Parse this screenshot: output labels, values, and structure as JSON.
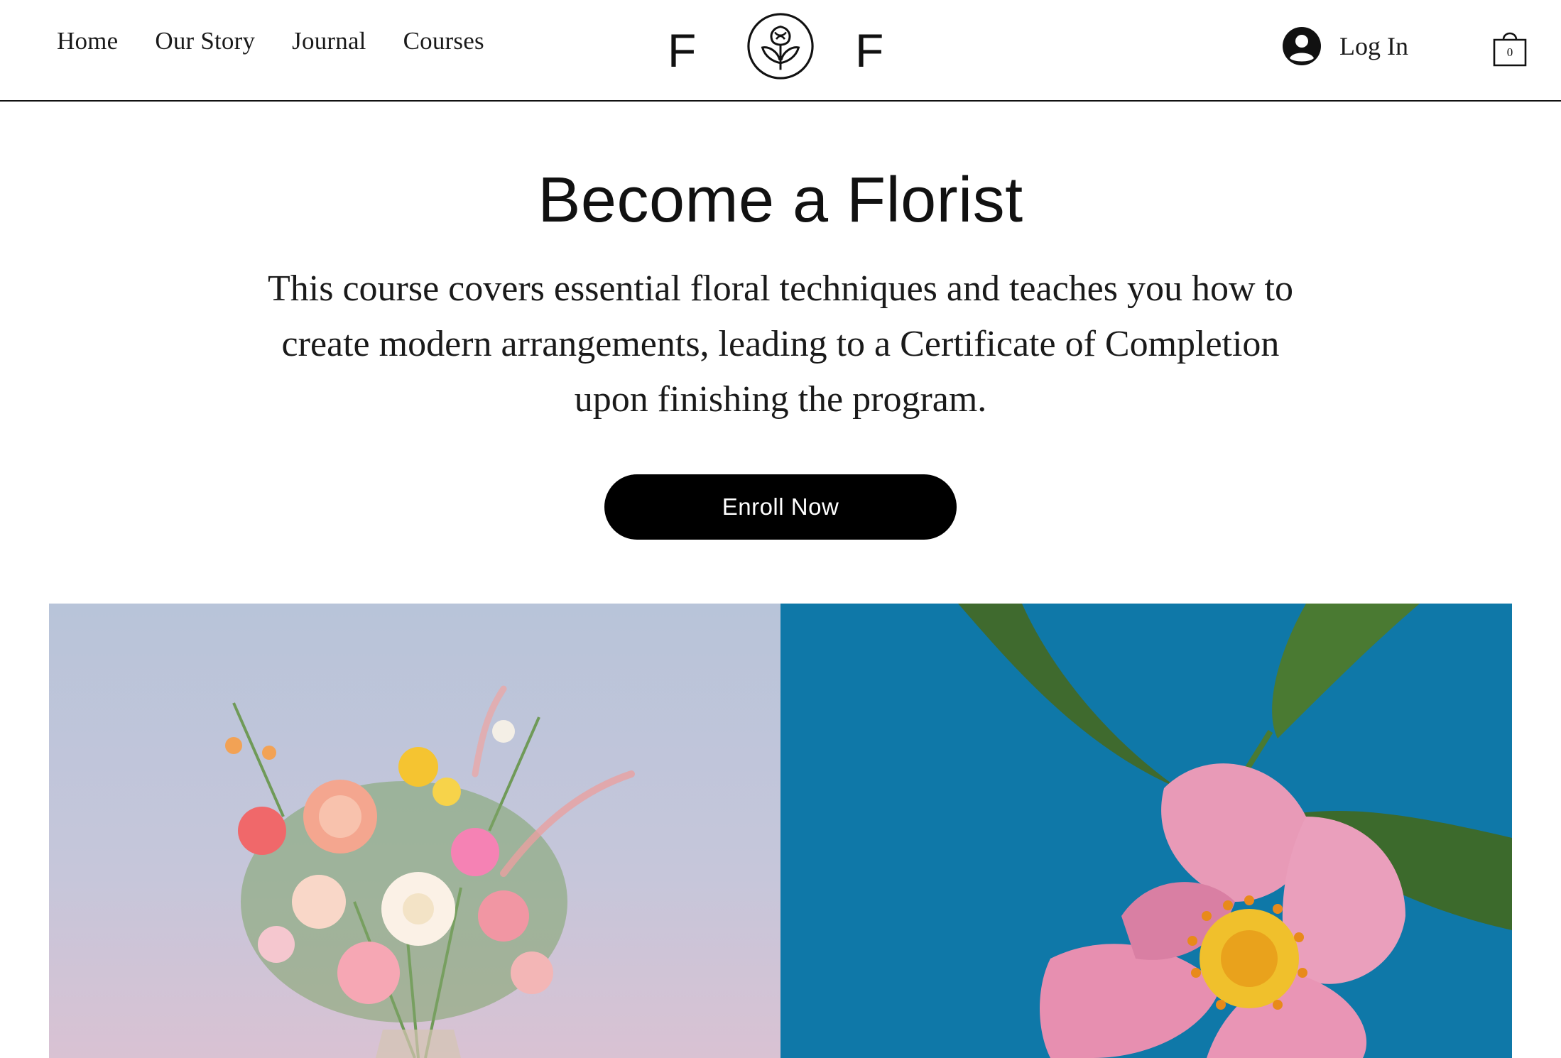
{
  "header": {
    "nav": [
      {
        "label": "Home"
      },
      {
        "label": "Our Story"
      },
      {
        "label": "Journal"
      },
      {
        "label": "Courses"
      }
    ],
    "logo": {
      "left_letter": "F",
      "right_letter": "F",
      "emblem_icon": "rose-in-hands-icon"
    },
    "login": {
      "label": "Log In",
      "icon": "user-avatar-icon"
    },
    "cart": {
      "count": "0",
      "icon": "shopping-bag-icon"
    }
  },
  "hero": {
    "title": "Become a Florist",
    "description": "This course covers essential floral techniques and teaches you how to create modern arrangements, leading to a Certificate of Completion upon finishing the program.",
    "cta_label": "Enroll Now"
  },
  "gallery": {
    "images": [
      {
        "subject": "pastel flower bouquet in vase"
      },
      {
        "subject": "pink wild rose on blue background"
      }
    ]
  },
  "colors": {
    "text": "#111111",
    "button_bg": "#000000",
    "button_text": "#ffffff",
    "background": "#ffffff",
    "image_left_sky": "#b9c3d8",
    "image_right_bg": "#0f78a8"
  }
}
